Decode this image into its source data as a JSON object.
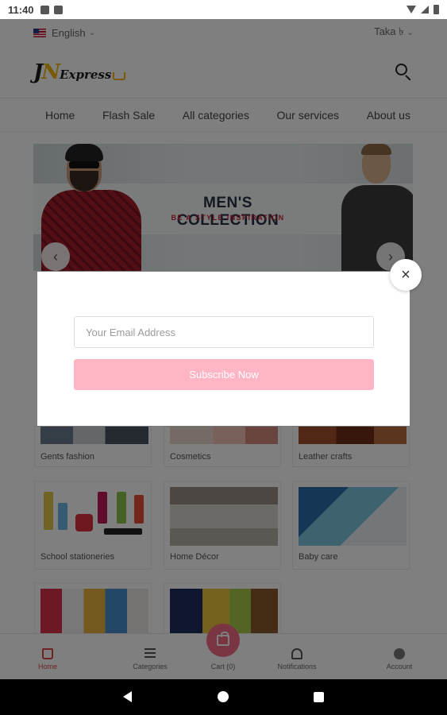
{
  "status_bar": {
    "time": "11:40"
  },
  "topbar": {
    "language": "English",
    "currency": "Taka ৳"
  },
  "header": {
    "logo_j": "J",
    "logo_n": "N",
    "logo_text": "Express",
    "search_icon": "search-icon"
  },
  "nav": {
    "items": [
      "Home",
      "Flash Sale",
      "All categories",
      "Our services",
      "About us"
    ]
  },
  "hero": {
    "title": "MEN'S COLLECTION",
    "subtitle": "BE A STYLE INSPIRATION",
    "prev": "‹",
    "next": "›"
  },
  "categories": [
    {
      "label": "Gents fashion"
    },
    {
      "label": "Cosmetics"
    },
    {
      "label": "Leather crafts"
    },
    {
      "label": "School stationeries"
    },
    {
      "label": "Home Décor"
    },
    {
      "label": "Baby care"
    },
    {
      "label": ""
    },
    {
      "label": ""
    }
  ],
  "bottom_nav": {
    "home": "Home",
    "categories": "Categories",
    "cart": "Cart (0)",
    "notifications": "Notifications",
    "account": "Account"
  },
  "modal": {
    "email_placeholder": "Your Email Address",
    "email_value": "",
    "subscribe_label": "Subscribe Now",
    "close": "×"
  },
  "colors": {
    "accent": "#f26d85",
    "subscribe_button": "#ffb5c4",
    "hero_title": "#263344",
    "hero_subtitle": "#c8233a",
    "logo_accent": "#f0b400"
  }
}
